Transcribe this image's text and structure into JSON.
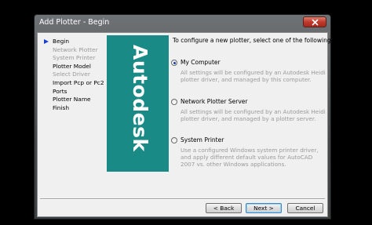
{
  "window": {
    "title": "Add Plotter - Begin"
  },
  "steps": [
    {
      "label": "Begin",
      "state": "current"
    },
    {
      "label": "Network Plotter",
      "state": "disabled"
    },
    {
      "label": "System Printer",
      "state": "disabled"
    },
    {
      "label": "Plotter Model",
      "state": "enabled"
    },
    {
      "label": "Select Driver",
      "state": "disabled"
    },
    {
      "label": "Import Pcp or Pc2",
      "state": "enabled"
    },
    {
      "label": "Ports",
      "state": "enabled"
    },
    {
      "label": "Plotter Name",
      "state": "enabled"
    },
    {
      "label": "Finish",
      "state": "enabled"
    }
  ],
  "brand": {
    "logo_text": "Autodesk"
  },
  "prompt": "To configure a new plotter, select one of the following:",
  "options": [
    {
      "label": "My Computer",
      "selected": true,
      "description": "All settings will be configured by an Autodesk Heidi plotter driver, and managed by this computer."
    },
    {
      "label": "Network Plotter Server",
      "selected": false,
      "description": "All settings will be configured by an Autodesk Heidi plotter driver, and managed by a plotter server."
    },
    {
      "label": "System Printer",
      "selected": false,
      "description": "Use a configured Windows system printer driver, and apply different default values for AutoCAD 2007 vs. other Windows applications."
    }
  ],
  "buttons": {
    "back": "< Back",
    "next": "Next >",
    "cancel": "Cancel"
  },
  "colors": {
    "brand_panel": "#1a8a86",
    "title_bar": "#45494c",
    "close": "#c0392b"
  },
  "icons": {
    "close": "close-icon",
    "current_step": "arrow-right-icon"
  }
}
